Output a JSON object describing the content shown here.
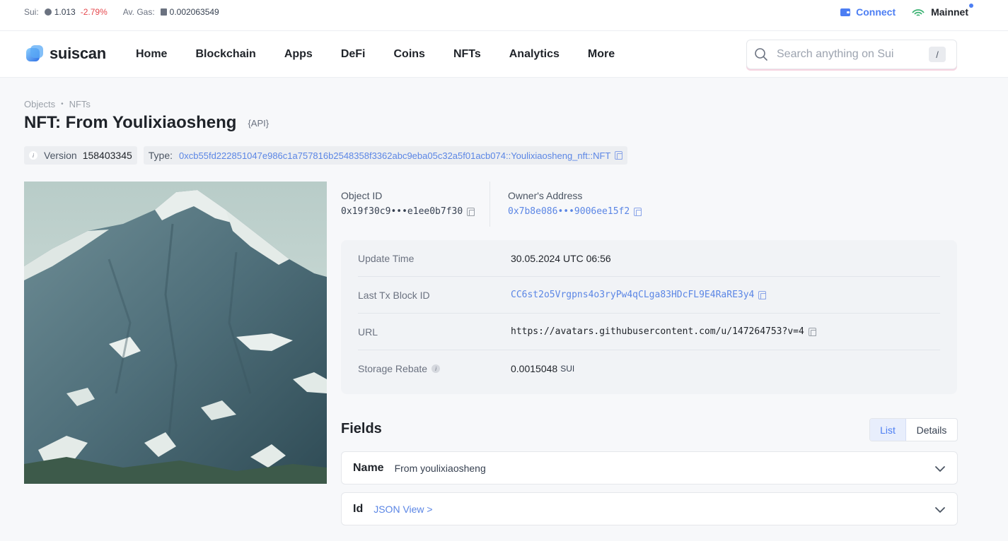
{
  "topbar": {
    "sui_label": "Sui:",
    "sui_price": "1.013",
    "sui_change": "-2.79%",
    "gas_label": "Av. Gas:",
    "gas_value": "0.002063549",
    "connect_label": "Connect",
    "network_label": "Mainnet"
  },
  "nav": {
    "logo_text": "suiscan",
    "menu": [
      "Home",
      "Blockchain",
      "Apps",
      "DeFi",
      "Coins",
      "NFTs",
      "Analytics",
      "More"
    ],
    "search_placeholder": "Search anything on Sui",
    "search_shortcut": "/"
  },
  "breadcrumb": [
    "Objects",
    "NFTs"
  ],
  "page": {
    "title": "NFT: From Youlixiaosheng",
    "api_label": "{API}",
    "version_label": "Version",
    "version_value": "158403345",
    "type_label": "Type:",
    "type_value": "0xcb55fd222851047e986c1a757816b2548358f3362abc9eba05c32a5f01acb074::Youlixiaosheng_nft::NFT"
  },
  "ids": {
    "object_id_label": "Object ID",
    "object_id_value": "0x19f30c9•••e1ee0b7f30",
    "owner_label": "Owner's Address",
    "owner_value": "0x7b8e086•••9006ee15f2"
  },
  "details": [
    {
      "label": "Update Time",
      "value": "30.05.2024 UTC 06:56"
    },
    {
      "label": "Last Tx Block ID",
      "value": "CC6st2o5Vrgpns4o3ryPw4qCLga83HDcFL9E4RaRE3y4"
    },
    {
      "label": "URL",
      "value": "https://avatars.githubusercontent.com/u/147264753?v=4"
    },
    {
      "label": "Storage Rebate",
      "value": "0.0015048",
      "unit": "SUI"
    }
  ],
  "fields": {
    "title": "Fields",
    "view_options": [
      "List",
      "Details"
    ],
    "active_view": "List",
    "rows": [
      {
        "name": "Name",
        "value": "From youlixiaosheng"
      },
      {
        "name": "Id",
        "value": "JSON View >"
      }
    ]
  },
  "colors": {
    "accent": "#4c7ef3",
    "link": "#5b86e5",
    "negative": "#e5484d"
  }
}
